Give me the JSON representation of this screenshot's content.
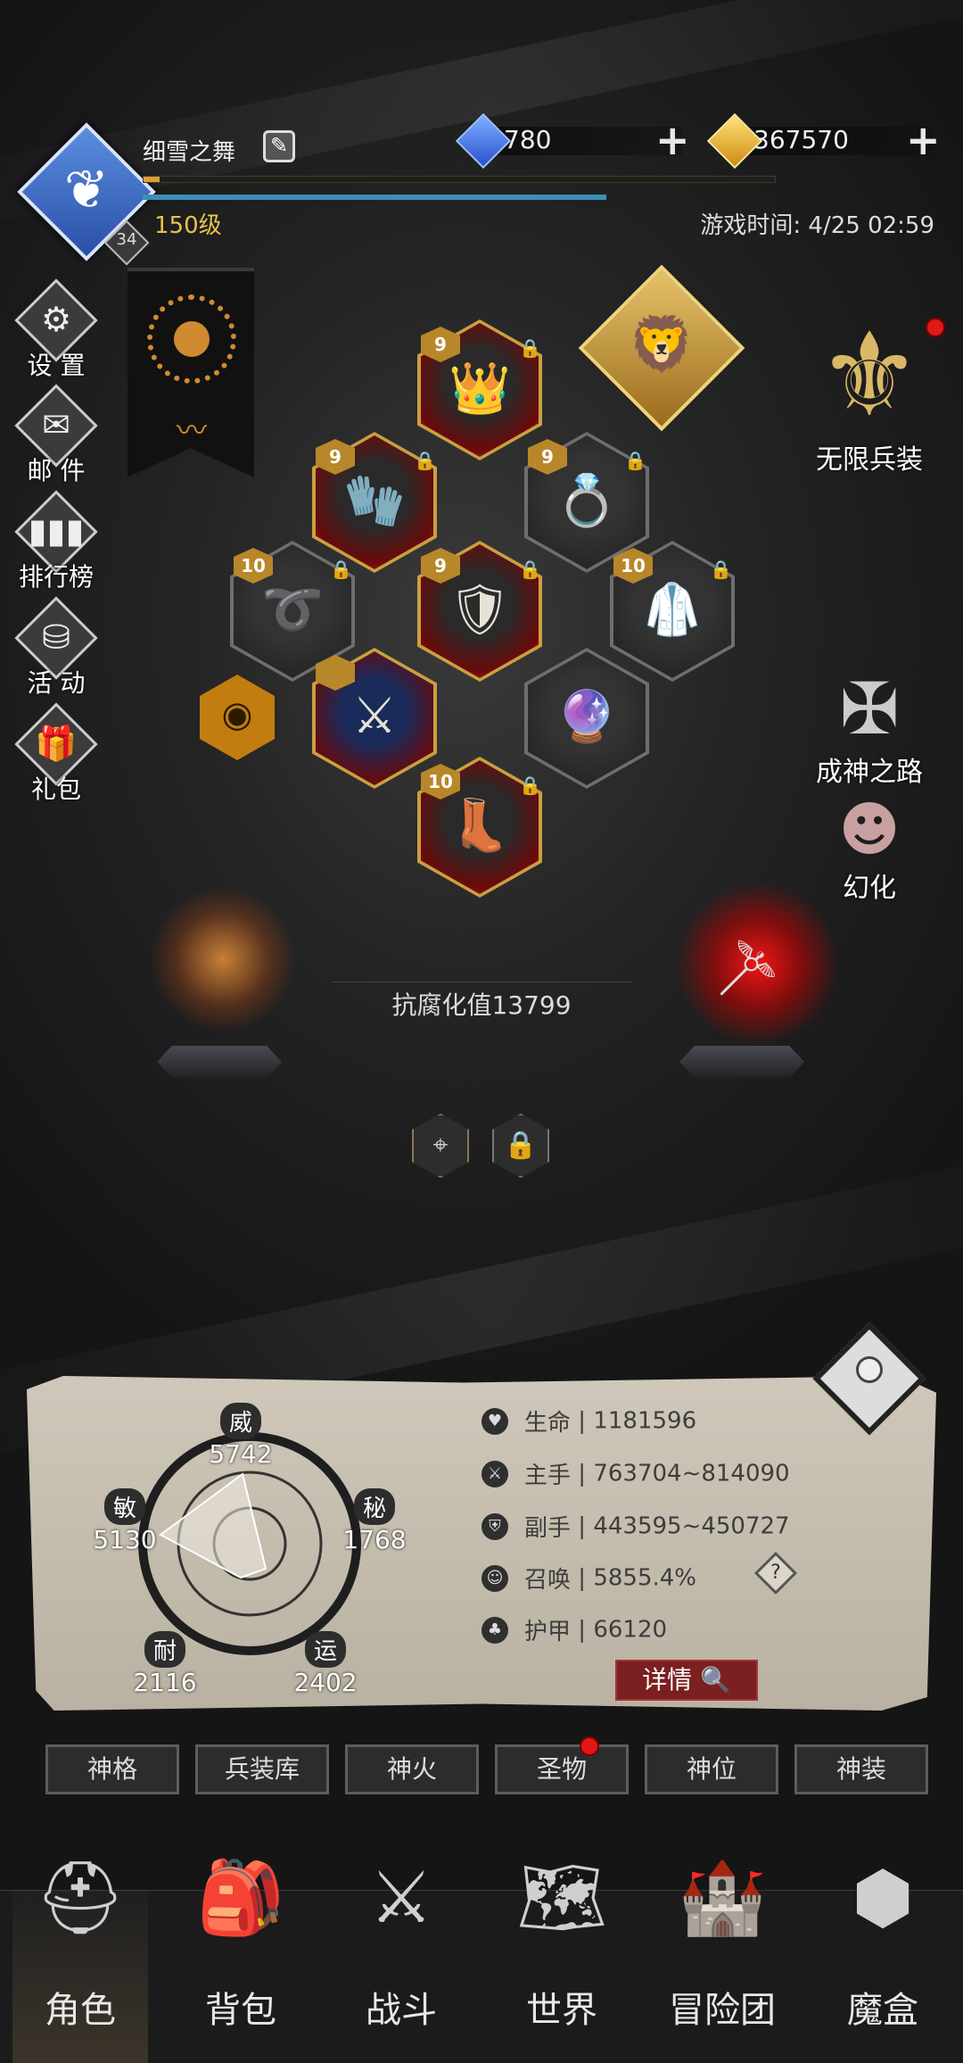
{
  "player": {
    "name": "细雪之舞",
    "level_label": "150级",
    "vip_level": "34",
    "game_time_label": "游戏时间: 4/25 02:59",
    "xp_fraction": 0.025
  },
  "currency": {
    "diamonds": "780",
    "gold": "367570",
    "diamond_color": "#3d7bff",
    "gold_color": "#f0b82a"
  },
  "left_menu": [
    {
      "label": "设 置",
      "icon": "gear-icon"
    },
    {
      "label": "邮 件",
      "icon": "mail-icon"
    },
    {
      "label": "排行榜",
      "icon": "ranking-icon"
    },
    {
      "label": "活 动",
      "icon": "activity-icon"
    },
    {
      "label": "礼包",
      "icon": "gift-icon"
    }
  ],
  "right_menu": {
    "infinite_arms": "无限兵装",
    "path_to_godhood": "成神之路",
    "transform": "幻化"
  },
  "equipment": [
    {
      "slot": "helmet",
      "level": "9",
      "icon": "crown-icon"
    },
    {
      "slot": "gloves",
      "level": "9",
      "icon": "glove-icon"
    },
    {
      "slot": "ring",
      "level": "9",
      "icon": "ring-icon"
    },
    {
      "slot": "belt",
      "level": "10",
      "icon": "belt-icon"
    },
    {
      "slot": "armor",
      "level": "9",
      "icon": "armor-icon"
    },
    {
      "slot": "cloak",
      "level": "10",
      "icon": "cloak-icon"
    },
    {
      "slot": "weapon",
      "level": "",
      "icon": "sword-icon"
    },
    {
      "slot": "orb",
      "level": "",
      "icon": "orb-icon"
    },
    {
      "slot": "boots",
      "level": "10",
      "icon": "boot-icon"
    }
  ],
  "anti_corrosion": "抗腐化值13799",
  "radar": {
    "wei": {
      "label": "威",
      "value": "5742"
    },
    "mi": {
      "label": "秘",
      "value": "1768"
    },
    "yun": {
      "label": "运",
      "value": "2402"
    },
    "nai": {
      "label": "耐",
      "value": "2116"
    },
    "min": {
      "label": "敏",
      "value": "5130"
    }
  },
  "attributes": [
    {
      "label": "生命",
      "value": "1181596",
      "icon": "heart-icon"
    },
    {
      "label": "主手",
      "value": "763704~814090",
      "icon": "mainhand-icon"
    },
    {
      "label": "副手",
      "value": "443595~450727",
      "icon": "offhand-icon"
    },
    {
      "label": "召唤",
      "value": "5855.4%",
      "icon": "summon-icon"
    },
    {
      "label": "护甲",
      "value": "66120",
      "icon": "armor-stat-icon"
    }
  ],
  "detail_label": "详情",
  "tabs": [
    "神格",
    "兵装库",
    "神火",
    "圣物",
    "神位",
    "神装"
  ],
  "nav": [
    "角色",
    "背包",
    "战斗",
    "世界",
    "冒险团",
    "魔盒"
  ],
  "active_nav": "角色"
}
